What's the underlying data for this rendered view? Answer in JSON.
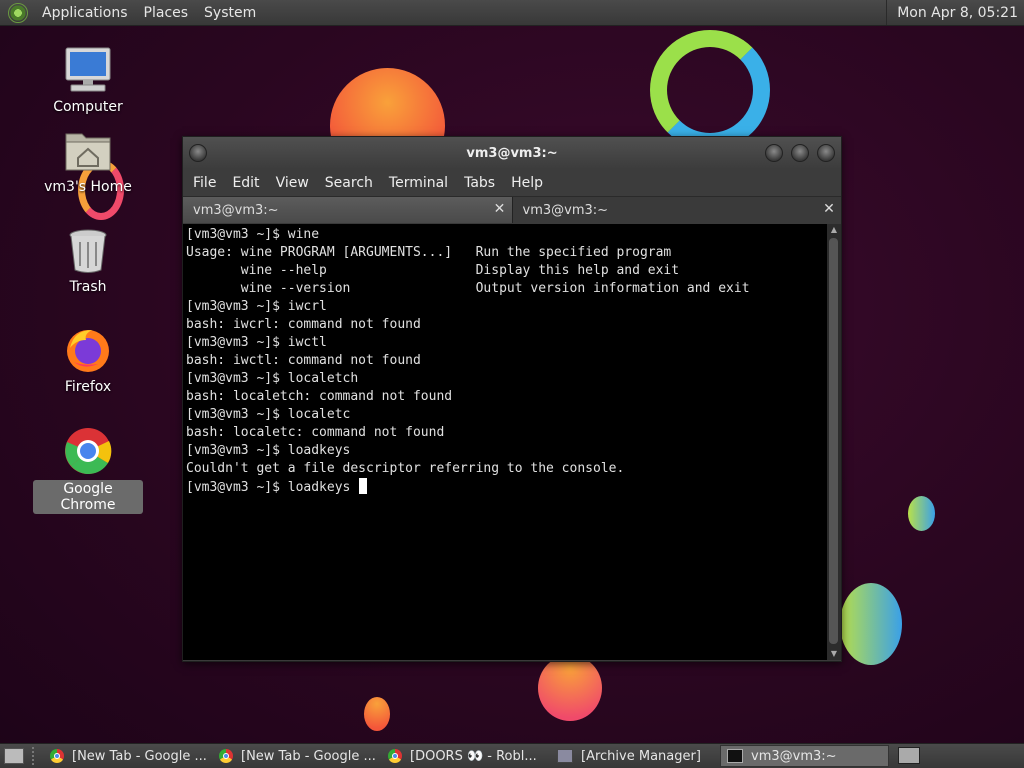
{
  "top_panel": {
    "menus": [
      "Applications",
      "Places",
      "System"
    ],
    "clock": "Mon Apr 8, 05:21"
  },
  "desktop": {
    "icons": [
      {
        "label": "Computer",
        "icon": "computer-icon"
      },
      {
        "label": "vm3's Home",
        "icon": "home-folder-icon"
      },
      {
        "label": "Trash",
        "icon": "trash-icon"
      },
      {
        "label": "Firefox",
        "icon": "firefox-icon"
      },
      {
        "label": "Google Chrome",
        "icon": "chrome-icon",
        "selected": true
      }
    ]
  },
  "terminal": {
    "title": "vm3@vm3:~",
    "menu": [
      "File",
      "Edit",
      "View",
      "Search",
      "Terminal",
      "Tabs",
      "Help"
    ],
    "tabs": [
      {
        "label": "vm3@vm3:~",
        "active": true
      },
      {
        "label": "vm3@vm3:~",
        "active": false
      }
    ],
    "lines": [
      "[vm3@vm3 ~]$ wine",
      "Usage: wine PROGRAM [ARGUMENTS...]   Run the specified program",
      "       wine --help                   Display this help and exit",
      "       wine --version                Output version information and exit",
      "[vm3@vm3 ~]$ iwcrl",
      "bash: iwcrl: command not found",
      "[vm3@vm3 ~]$ iwctl",
      "bash: iwctl: command not found",
      "[vm3@vm3 ~]$ localetch",
      "bash: localetch: command not found",
      "[vm3@vm3 ~]$ localetc",
      "bash: localetc: command not found",
      "[vm3@vm3 ~]$ loadkeys",
      "Couldn't get a file descriptor referring to the console."
    ],
    "current_line": "[vm3@vm3 ~]$ loadkeys "
  },
  "taskbar": {
    "items": [
      {
        "label": "[New Tab - Google ...",
        "icon": "chrome-icon"
      },
      {
        "label": "[New Tab - Google ...",
        "icon": "chrome-icon"
      },
      {
        "label": "[DOORS 👀 - Robl...",
        "icon": "chrome-icon"
      },
      {
        "label": "[Archive Manager]",
        "icon": "archive-icon"
      },
      {
        "label": "vm3@vm3:~",
        "icon": "terminal-icon",
        "active": true
      }
    ]
  },
  "colors": {
    "desktop_bg": "#2a0620",
    "panel": "#404040",
    "terminal_bg": "#000000",
    "terminal_fg": "#e0e0e0"
  }
}
